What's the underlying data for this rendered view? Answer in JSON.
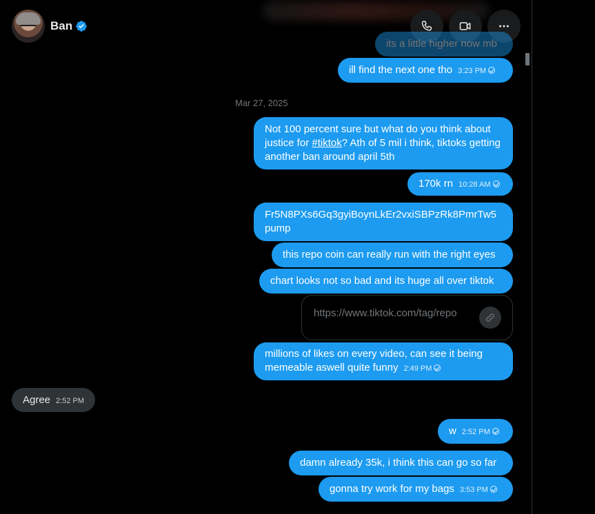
{
  "header": {
    "name": "Ban",
    "verified": true,
    "buttons": [
      "phone-icon",
      "video-icon",
      "more-icon"
    ]
  },
  "date_separator": "Mar 27, 2025",
  "messages": [
    {
      "dir": "out",
      "text": "its a little higher now mb",
      "time": ""
    },
    {
      "dir": "out",
      "text": "ill find the next one tho",
      "time": "3:23 PM"
    },
    {
      "dir": "out",
      "text_pre": "Not 100 percent sure but what do you think about justice for ",
      "hashtag": "#tiktok",
      "text_post": "? Ath of 5 mil i think, tiktoks getting another ban around april 5th",
      "time": ""
    },
    {
      "dir": "out",
      "text": "170k rn",
      "time": "10:28 AM"
    },
    {
      "dir": "out",
      "text_line1": "Fr5N8PXs6Gq3gyiBoynLkEr2vxiSBPzRk8PmrTw5",
      "text_line2": "pump",
      "time": ""
    },
    {
      "dir": "out",
      "text": "this repo coin can really run with the right eyes",
      "time": ""
    },
    {
      "dir": "out",
      "text": "chart looks not so bad and its huge all over tiktok",
      "time": ""
    },
    {
      "dir": "out",
      "type": "link",
      "url": "https://www.tiktok.com/tag/repo"
    },
    {
      "dir": "out",
      "text": "millions of likes on every video, can see it being memeable aswell quite funny",
      "time": "2:49 PM"
    },
    {
      "dir": "in",
      "text": "Agree",
      "time": "2:52 PM"
    },
    {
      "dir": "out",
      "text": "w",
      "time": "2:52 PM"
    },
    {
      "dir": "out",
      "text": "damn already 35k, i think this can go so far",
      "time": ""
    },
    {
      "dir": "out",
      "text": "gonna try work for my bags",
      "time": "3:53 PM"
    }
  ],
  "colors": {
    "outgoing": "#1d9bf0",
    "incoming": "#2f3336",
    "background": "#000000",
    "verified": "#1d9bf0"
  }
}
